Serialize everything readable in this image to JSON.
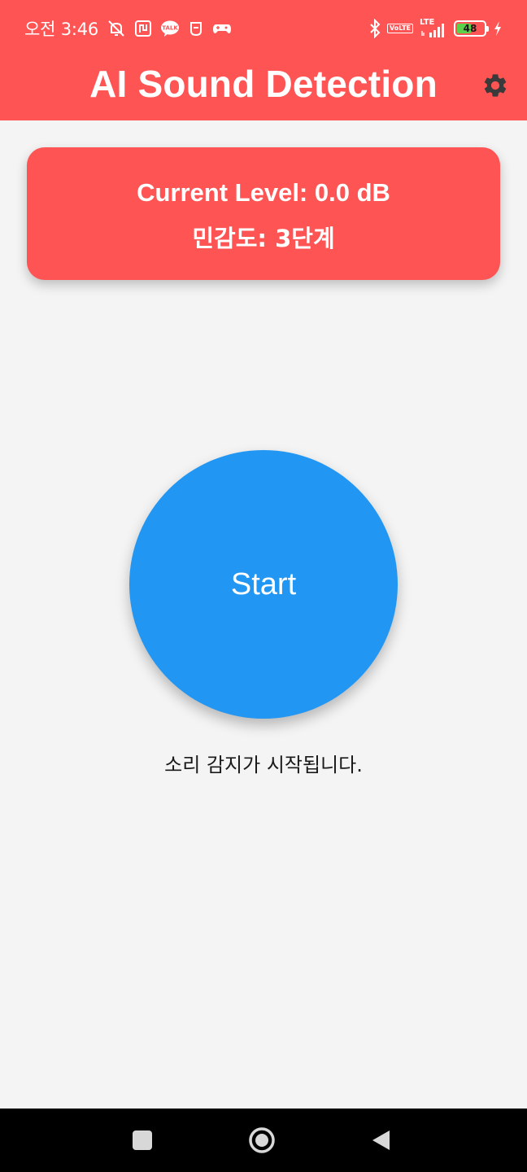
{
  "status_bar": {
    "time": "오전 3:46",
    "icons_left": [
      "mute-icon",
      "nfc-icon",
      "kakaotalk-icon",
      "notification-app-icon",
      "gamepad-icon"
    ],
    "kakaotalk_label": "TALK",
    "volte_label_top": "Vo",
    "volte_label_bottom": "LTE",
    "network_label": "LTE",
    "icons_right": [
      "bluetooth-icon",
      "volte-icon",
      "lte-signal-icon",
      "battery-icon",
      "charging-icon"
    ],
    "battery_level": "48",
    "battery_color": "#5bd14a"
  },
  "app_bar": {
    "title": "AI Sound Detection",
    "settings_icon": "gear-icon",
    "background_color": "#ff5454",
    "icon_color": "#3a3a3a"
  },
  "level_card": {
    "current_level": "Current Level: 0.0 dB",
    "sensitivity": "민감도: 3단계"
  },
  "main": {
    "start_label": "Start",
    "start_color": "#2196f3",
    "status_message": "소리 감지가 시작됩니다."
  },
  "nav_bar": {
    "buttons": [
      "recent-apps-icon",
      "home-icon",
      "back-icon"
    ]
  }
}
